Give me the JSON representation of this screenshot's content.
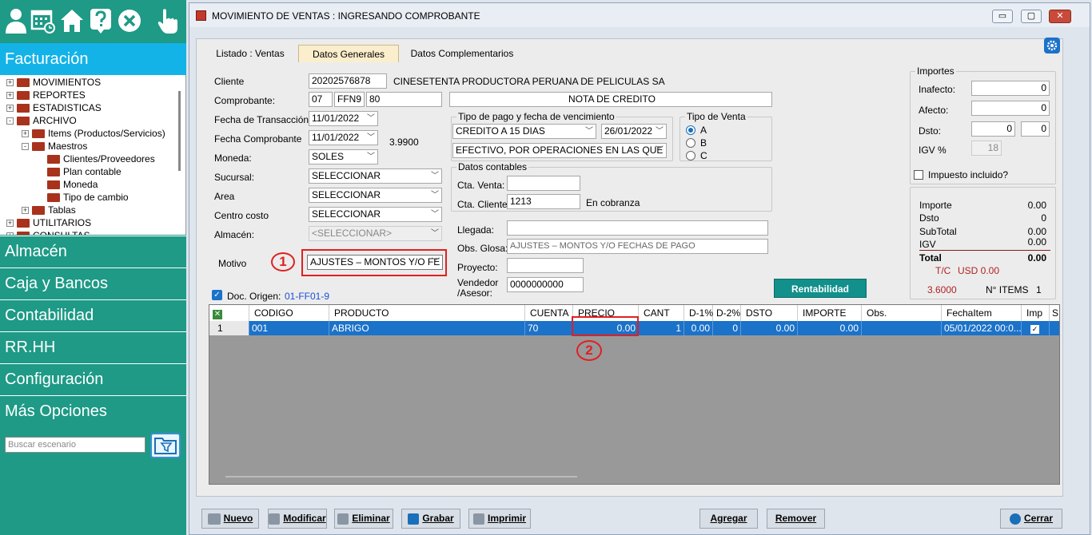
{
  "sidebar": {
    "icons": [
      "user-icon",
      "calendar-icon",
      "home-icon",
      "help-icon",
      "close-icon",
      "hand-pointer-icon"
    ],
    "active_module": "Facturación",
    "tree": [
      {
        "label": "MOVIMIENTOS",
        "level": 0,
        "expander": "+"
      },
      {
        "label": "REPORTES",
        "level": 0,
        "expander": "+"
      },
      {
        "label": "ESTADISTICAS",
        "level": 0,
        "expander": "+"
      },
      {
        "label": "ARCHIVO",
        "level": 0,
        "expander": "-"
      },
      {
        "label": "Items (Productos/Servicios)",
        "level": 1,
        "expander": "+"
      },
      {
        "label": "Maestros",
        "level": 1,
        "expander": "-"
      },
      {
        "label": "Clientes/Proveedores",
        "level": 2,
        "expander": ""
      },
      {
        "label": "Plan contable",
        "level": 2,
        "expander": ""
      },
      {
        "label": "Moneda",
        "level": 2,
        "expander": ""
      },
      {
        "label": "Tipo de cambio",
        "level": 2,
        "expander": ""
      },
      {
        "label": "Tablas",
        "level": 1,
        "expander": "+"
      },
      {
        "label": "UTILITARIOS",
        "level": 0,
        "expander": "+"
      },
      {
        "label": "CONSULTAS",
        "level": 0,
        "expander": "+"
      }
    ],
    "modules": [
      "Almacén",
      "Caja y Bancos",
      "Contabilidad",
      "RR.HH",
      "Configuración",
      "Más Opciones"
    ],
    "search_placeholder": "Buscar escenario"
  },
  "window": {
    "title": "MOVIMIENTO DE VENTAS : INGRESANDO COMPROBANTE",
    "controls": [
      "▭",
      "▢",
      "✕"
    ],
    "tabs": [
      "Listado : Ventas",
      "Datos Generales",
      "Datos Complementarios"
    ],
    "active_tab": "Datos Generales"
  },
  "form": {
    "cliente_label": "Cliente",
    "cliente_ruc": "20202576878",
    "cliente_nombre": "CINESETENTA PRODUCTORA PERUANA DE PELICULAS SA",
    "comprobante_label": "Comprobante:",
    "comprobante_tipo": "07",
    "comprobante_serie": "FFN9",
    "comprobante_numero": "80",
    "comprobante_desc": "NOTA DE CREDITO",
    "fecha_trans_label": "Fecha de Transacción",
    "fecha_trans": "11/01/2022",
    "fecha_comp_label": "Fecha Comprobante",
    "fecha_comp": "11/01/2022",
    "tipo_cambio": "3.9900",
    "moneda_label": "Moneda:",
    "moneda": "SOLES",
    "sucursal_label": "Sucursal:",
    "sucursal": "SELECCIONAR",
    "area_label": "Area",
    "area": "SELECCIONAR",
    "centro_label": "Centro costo",
    "centro": "SELECCIONAR",
    "almacen_label": "Almacén:",
    "almacen": "<SELECCIONAR>",
    "motivo_label": "Motivo",
    "motivo": "AJUSTES – MONTOS Y/O FE",
    "doc_origen_label": "Doc. Origen:",
    "doc_origen": "01-FF01-9",
    "tipo_pago_group": "Tipo de pago y fecha de vencimiento",
    "tipo_pago": "CREDITO A 15 DIAS",
    "fecha_venc": "26/01/2022",
    "medio_pago": "EFECTIVO, POR OPERACIONES EN LAS QUE NO",
    "tipo_venta_group": "Tipo de Venta",
    "tipo_venta_options": [
      "A",
      "B",
      "C"
    ],
    "tipo_venta_selected": "A",
    "contables_group": "Datos contables",
    "cta_venta_label": "Cta. Venta:",
    "cta_venta": "",
    "cta_cliente_label": "Cta. Cliente:",
    "cta_cliente": "1213",
    "cta_cliente_status": "En cobranza",
    "llegada_label": "Llegada:",
    "llegada": "",
    "obs_glosa_label": "Obs. Glosa:",
    "obs_glosa": "AJUSTES – MONTOS Y/O FECHAS DE PAGO",
    "proyecto_label": "Proyecto:",
    "proyecto": "",
    "vendedor_label1": "Vendedor",
    "vendedor_label2": "/Asesor:",
    "vendedor": "0000000000",
    "rentabilidad_btn": "Rentabilidad"
  },
  "importes": {
    "group": "Importes",
    "inafecto_label": "Inafecto:",
    "inafecto": "0",
    "afecto_label": "Afecto:",
    "afecto": "0",
    "dsto_label": "Dsto:",
    "dsto1": "0",
    "dsto2": "0",
    "igv_label": "IGV %",
    "igv": "18",
    "impuesto_incluido": "Impuesto incluido?",
    "importe_label": "Importe",
    "importe": "0.00",
    "dsto_sum_label": "Dsto",
    "dsto_sum": "0",
    "subtotal_label": "SubTotal",
    "subtotal": "0.00",
    "igv_sum_label": "IGV",
    "igv_sum": "0.00",
    "total_label": "Total",
    "total": "0.00",
    "tc_label": "T/C",
    "usd": "USD 0.00",
    "tc_value": "3.6000",
    "items_label": "N° ITEMS",
    "items": "1"
  },
  "grid": {
    "headers": [
      "CODIGO",
      "PRODUCTO",
      "CUENTA",
      "PRECIO",
      "CANT",
      "D-1%",
      "D-2%",
      "DSTO",
      "IMPORTE",
      "Obs.",
      "FechaItem",
      "Imp",
      "S"
    ],
    "row": {
      "num": "1",
      "codigo": "001",
      "producto": "ABRIGO",
      "cuenta": "70",
      "precio": "0.00",
      "cant": "1",
      "d1": "0.00",
      "d2": "0",
      "dsto": "0.00",
      "importe": "0.00",
      "obs": "",
      "fecha": "05/01/2022 00:0..."
    }
  },
  "annotations": {
    "one": "1",
    "two": "2"
  },
  "buttons": {
    "nuevo": "Nuevo",
    "modificar": "Modificar",
    "eliminar": "Eliminar",
    "grabar": "Grabar",
    "imprimir": "Imprimir",
    "agregar": "Agregar",
    "remover": "Remover",
    "cerrar": "Cerrar"
  },
  "colors": {
    "sidebar": "#1e9a86",
    "active_module": "#13b3e8",
    "selected_row": "#1b72c9",
    "highlight": "#e02020"
  }
}
